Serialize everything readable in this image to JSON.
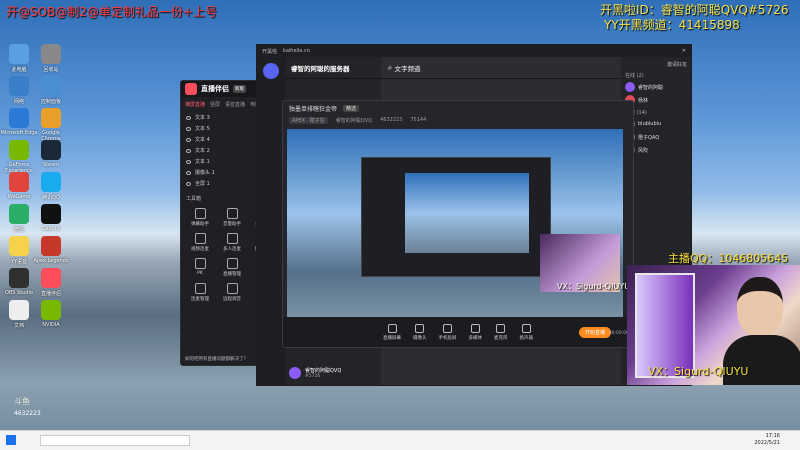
{
  "overlay": {
    "top_left": "开@SOB@制2@单定制礼品一份+上号",
    "streamer_id": "开黑啦ID：睿智的阿聪QVQ#5726",
    "yy_channel": "YY开黑频道：41415898",
    "host_qq": "主播QQ：1046805645",
    "vx": "VX：Sigurd-QIUYU",
    "vx_small": "VX：Sigurd-QIUYU"
  },
  "desktop_icons": [
    "此电脑",
    "回收站",
    "网络",
    "控制面板",
    "Microsoft Edge",
    "Google Chrome",
    "GeForce Experience",
    "Steam",
    "WeGame",
    "腾讯QQ",
    "微信",
    "CapCut",
    "YY语音",
    "Apex Legends",
    "OBS Studio",
    "直播伴侣",
    "文档",
    "NVIDIA"
  ],
  "zhibo": {
    "app_name": "直播伴侣",
    "badge": "新版",
    "tabs": [
      "横屏直播",
      "竖屏",
      "语音直播",
      "电脑"
    ],
    "scenes": [
      "文本 3",
      "文本 5",
      "文本 4",
      "文本 2",
      "文本 1",
      "摄像头 1",
      "全屏 1"
    ],
    "tools_title": "工具箱",
    "tools": [
      "弹幕助手",
      "音量助手",
      "主播任务",
      "视频连麦",
      "多人连麦",
      "精彩瞬间",
      "PK",
      "直播管理",
      "连麦PK",
      "连麦管理",
      "远程调音",
      "弹幕库"
    ],
    "notice": "如何把所有直播问题都解决了?"
  },
  "khl": {
    "app_label": "开黑啦",
    "url": "kaiheila.cn",
    "server_name": "睿智的阿聪的服务器",
    "channel_name": "文字频道",
    "invite_label": "邀请好友",
    "online_header": "在线 (2)",
    "offline_header": "离线 (14)",
    "members": [
      "睿智的阿聪",
      "杨林",
      "blublublu",
      "橙子QAQ",
      "风吹"
    ],
    "bottom_user": "睿智的阿聪QVQ",
    "bottom_tag": "#5726"
  },
  "viewer": {
    "title": "独墨单排瞎狂金帝",
    "badge": "精选",
    "game": "APEX · 瞎子狂",
    "host": "睿智的阿聪QVQ",
    "room_id": "4632223",
    "viewers": "75144",
    "controls": [
      "直播屏幕",
      "摄像头",
      "手机投屏",
      "多媒体",
      "麦克风",
      "扬声器"
    ],
    "start_label": "开始直播",
    "time": "00:00:00"
  },
  "taskbar": {
    "time": "17:16",
    "date": "2022/5/21",
    "room": "4632223",
    "logo": "斗鱼"
  }
}
